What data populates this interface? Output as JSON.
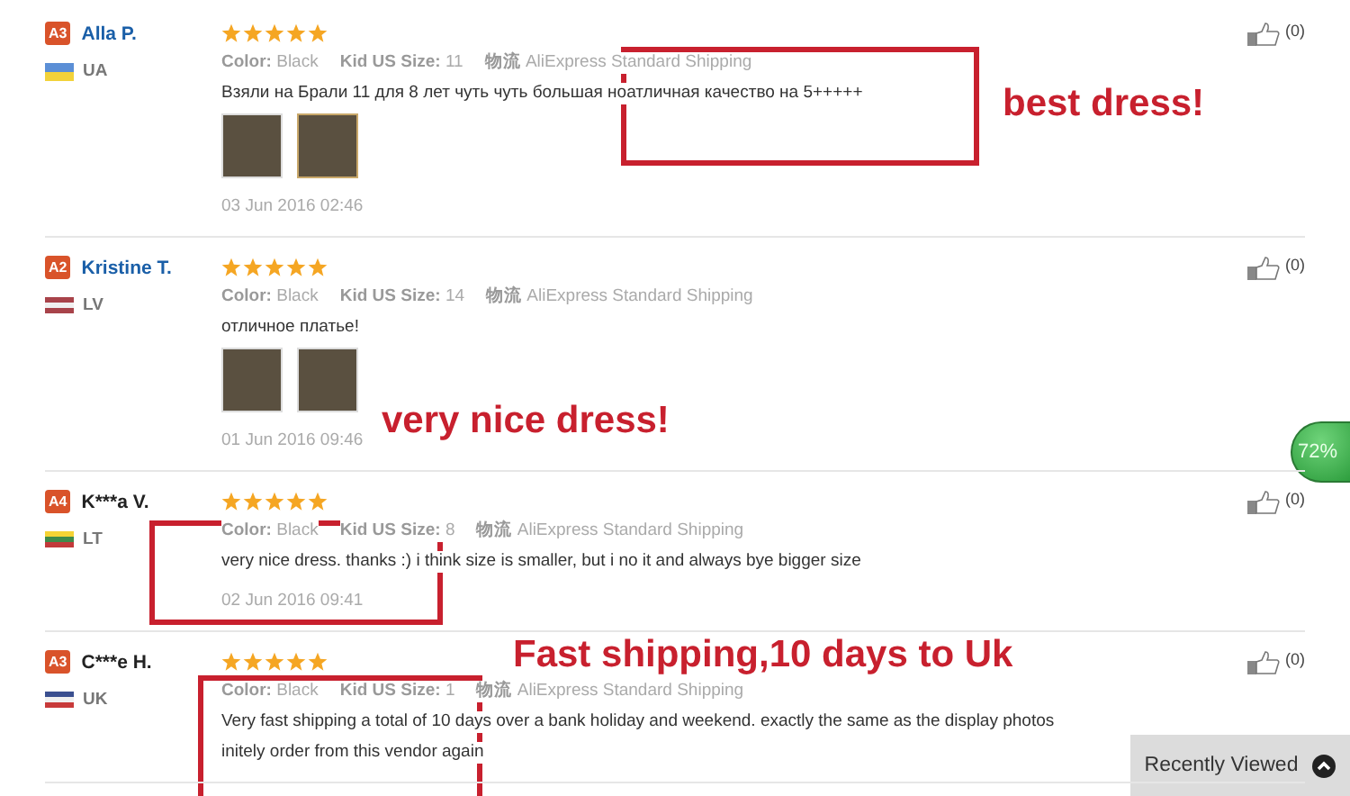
{
  "reviews": [
    {
      "level_badge": "A3",
      "name": "Alla P.",
      "linked": true,
      "country": "UA",
      "stars": 5,
      "attributes": [
        {
          "label": "Color:",
          "value": "Black"
        },
        {
          "label": "Kid US Size:",
          "value": "11"
        },
        {
          "label": "物流",
          "value": "AliExpress Standard Shipping"
        }
      ],
      "text": "Взяли на Брали 11 для 8 лет чуть чуть большая ноатличная качество на 5+++++",
      "photos": [
        {
          "selected": false
        },
        {
          "selected": true
        }
      ],
      "date": "03 Jun 2016 02:46",
      "likes": "(0)"
    },
    {
      "level_badge": "A2",
      "name": "Kristine T.",
      "linked": true,
      "country": "LV",
      "stars": 5,
      "attributes": [
        {
          "label": "Color:",
          "value": "Black"
        },
        {
          "label": "Kid US Size:",
          "value": "14"
        },
        {
          "label": "物流",
          "value": "AliExpress Standard Shipping"
        }
      ],
      "text": "отличное платье!",
      "photos": [
        {
          "selected": false
        },
        {
          "selected": false
        }
      ],
      "date": "01 Jun 2016 09:46",
      "likes": "(0)"
    },
    {
      "level_badge": "A4",
      "name": "K***a V.",
      "linked": false,
      "country": "LT",
      "stars": 5,
      "attributes": [
        {
          "label": "Color:",
          "value": "Black"
        },
        {
          "label": "Kid US Size:",
          "value": "8"
        },
        {
          "label": "物流",
          "value": "AliExpress Standard Shipping"
        }
      ],
      "text": "very nice dress. thanks :) i think size is smaller, but i no it and always bye bigger size",
      "date": "02 Jun 2016 09:41",
      "likes": "(0)"
    },
    {
      "level_badge": "A3",
      "name": "C***e H.",
      "linked": false,
      "country": "UK",
      "stars": 5,
      "attributes": [
        {
          "label": "Color:",
          "value": "Black"
        },
        {
          "label": "Kid US Size:",
          "value": "1"
        },
        {
          "label": "物流",
          "value": "AliExpress Standard Shipping"
        }
      ],
      "text": "Very fast shipping a total of 10 days over a bank holiday and weekend. exactly the same as the display photos",
      "text_continued": "initely order from this vendor again",
      "likes": "(0)"
    }
  ],
  "annotations": [
    {
      "kind": "box"
    },
    {
      "kind": "label",
      "text": "best dress!"
    },
    {
      "kind": "label",
      "text": "very nice dress!"
    },
    {
      "kind": "box"
    },
    {
      "kind": "label",
      "text": "Fast shipping,10 days to Uk"
    },
    {
      "kind": "box"
    }
  ],
  "progress_badge": "72%",
  "recently_viewed": "Recently Viewed"
}
